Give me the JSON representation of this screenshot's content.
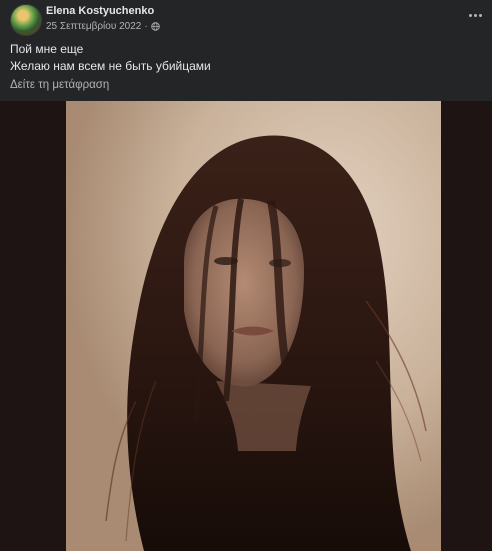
{
  "post": {
    "author": "Elena Kostyuchenko",
    "date": "25 Σεπτεμβρίου 2022",
    "separator": "·",
    "audience_icon": "globe-icon",
    "more_icon": "more-horizontal-icon",
    "lines": [
      "Пой мне еще",
      "Желаю нам всем не быть убийцами"
    ],
    "see_translation": "Δείτε τη μετάφραση"
  },
  "colors": {
    "background": "#242526",
    "primary_text": "#e4e6eb",
    "secondary_text": "#b0b3b8"
  }
}
